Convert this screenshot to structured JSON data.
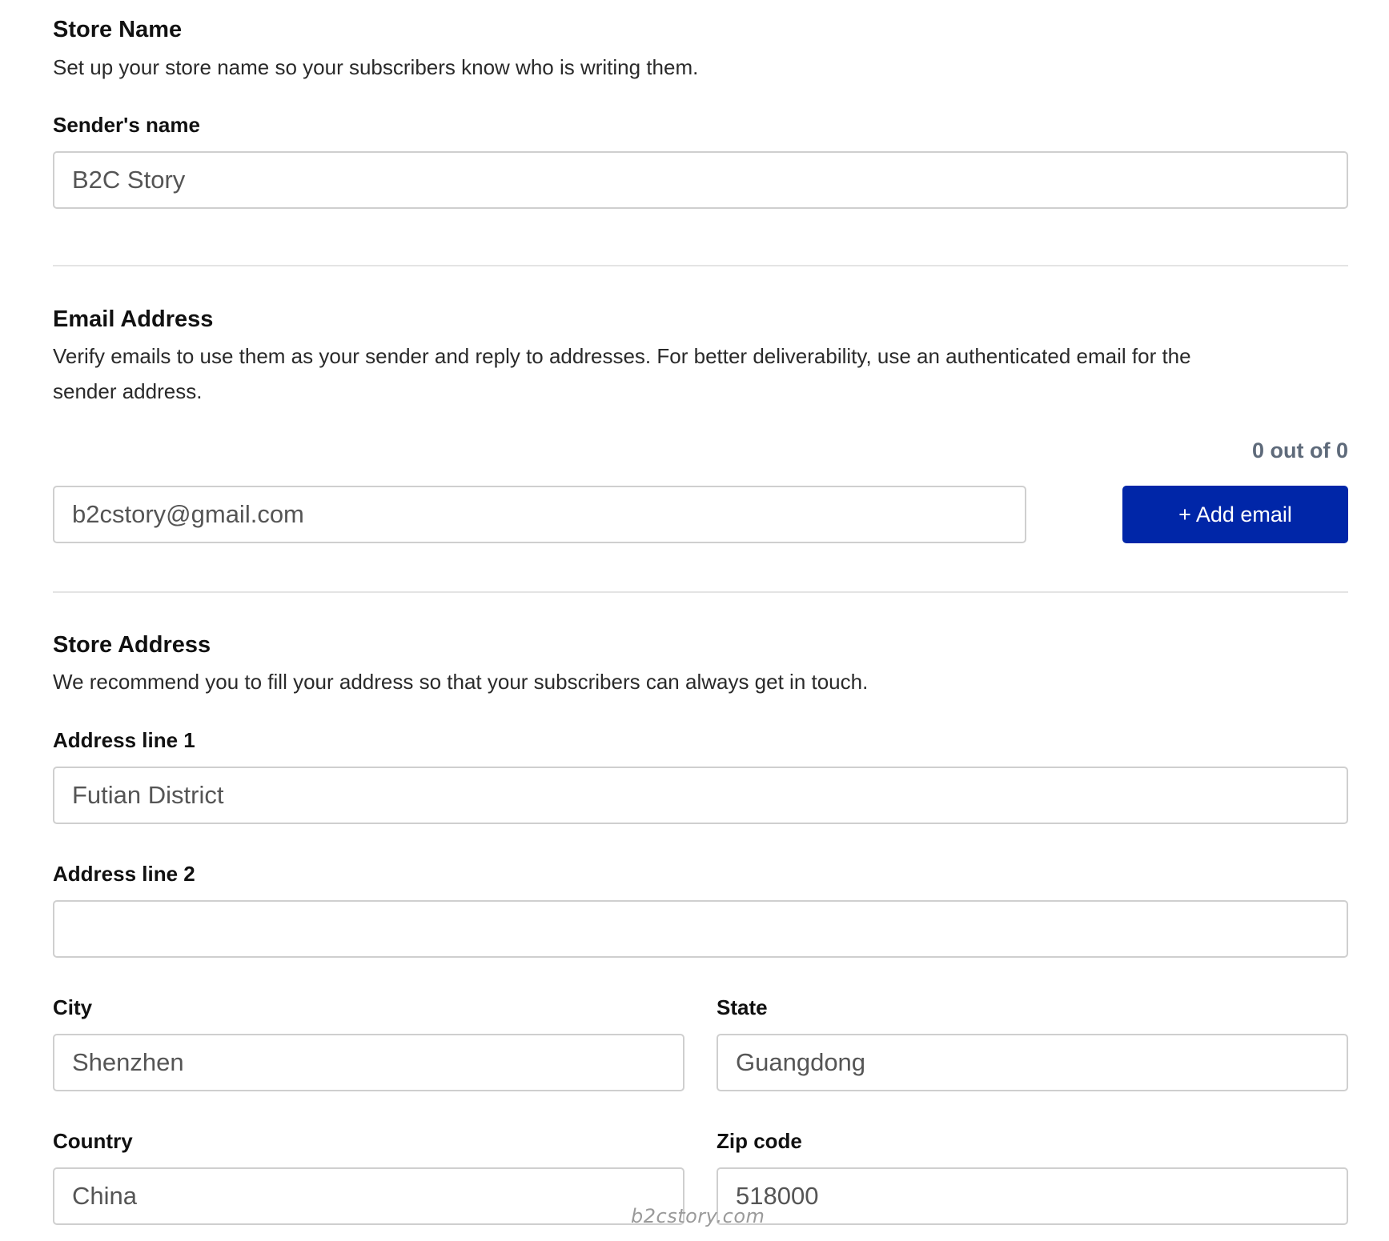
{
  "store_name": {
    "title": "Store Name",
    "description": "Set up your store name so your subscribers know who is writing them.",
    "sender_label": "Sender's name",
    "sender_value": "B2C Story"
  },
  "email_address": {
    "title": "Email Address",
    "description_line1": "Verify emails to use them as your sender and reply to addresses. For better deliverability, use an authenticated email for the",
    "description_line2": "sender address.",
    "counter": "0 out of 0",
    "email_value": "b2cstory@gmail.com",
    "add_button_label": "+ Add email",
    "accent_color": "#0026a8"
  },
  "store_address": {
    "title": "Store Address",
    "description": "We recommend you to fill your address so that your subscribers can always get in touch.",
    "address1_label": "Address line 1",
    "address1_value": "Futian District",
    "address2_label": "Address line 2",
    "address2_value": "",
    "city_label": "City",
    "city_value": "Shenzhen",
    "state_label": "State",
    "state_value": "Guangdong",
    "country_label": "Country",
    "country_value": "China",
    "zip_label": "Zip code",
    "zip_value": "518000"
  },
  "watermark": "b2cstory.com"
}
